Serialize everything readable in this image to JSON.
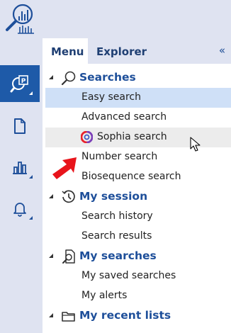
{
  "tabs": {
    "menu": "Menu",
    "explorer": "Explorer",
    "collapse": "«"
  },
  "rail": {
    "logo_icon": "search-chart-logo",
    "items": [
      {
        "icon": "patent-search-icon",
        "active": true
      },
      {
        "icon": "document-icon",
        "active": false
      },
      {
        "icon": "bar-chart-icon",
        "active": false
      },
      {
        "icon": "bell-icon",
        "active": false
      }
    ]
  },
  "menu": {
    "sections": [
      {
        "title": "Searches",
        "icon": "magnifier-icon",
        "items": [
          "Easy search",
          "Advanced search",
          "Sophia search",
          "Number search",
          "Biosequence search"
        ]
      },
      {
        "title": "My session",
        "icon": "history-clock-icon",
        "items": [
          "Search history",
          "Search results"
        ]
      },
      {
        "title": "My searches",
        "icon": "saved-search-document-icon",
        "items": [
          "My saved searches",
          "My alerts"
        ]
      },
      {
        "title": "My recent lists",
        "icon": "folder-icon",
        "items": []
      }
    ],
    "selected_item": "Easy search",
    "hovered_item": "Sophia search"
  },
  "colors": {
    "accent": "#1e5aa8",
    "section_title": "#1e4f9a",
    "rail_bg": "#dfe3f1",
    "selected_bg": "#cfe0f7",
    "hover_bg": "#ececec",
    "annotation_arrow": "#e8141b"
  }
}
